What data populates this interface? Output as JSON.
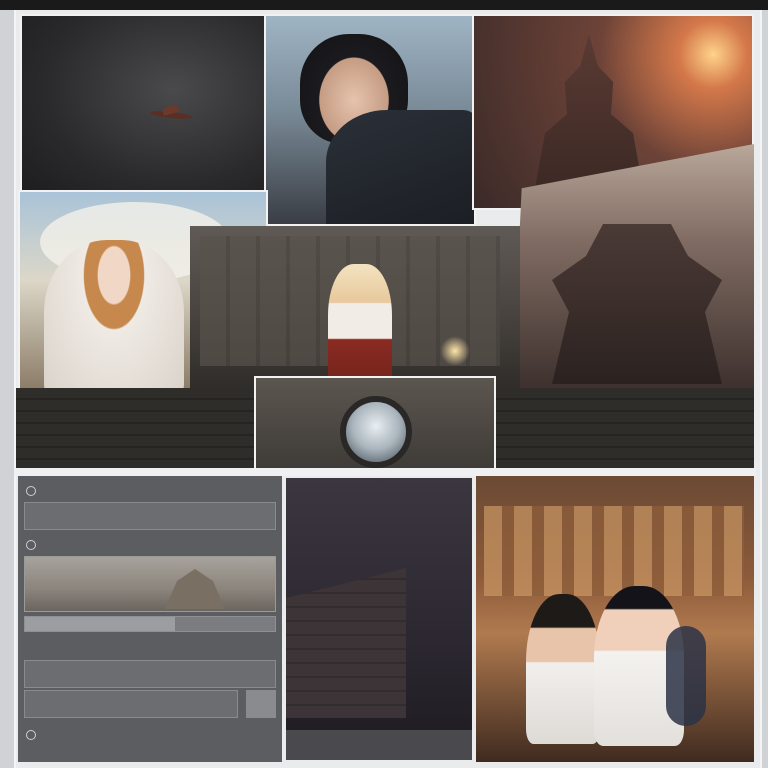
{
  "ui_panel": {
    "heading": "",
    "rows": [
      "",
      "",
      "",
      ""
    ],
    "sub_heading": "",
    "progress_fraction": 0.6,
    "button_label": "",
    "footer_lines": [
      "",
      ""
    ]
  },
  "corridor_caption": "",
  "colors": {
    "page_background": "#e9ebec",
    "panel_border": "#f2f2f2",
    "ui_panel_bg": "#5c5d60"
  },
  "icons": [
    "circle-icon",
    "circle-icon",
    "circle-icon"
  ]
}
